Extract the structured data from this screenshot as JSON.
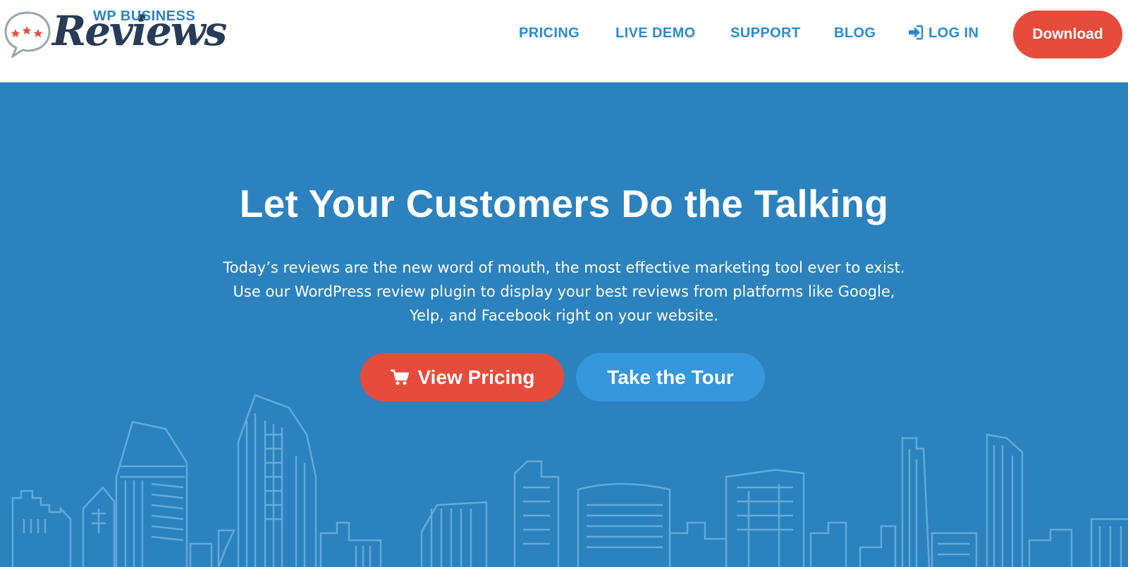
{
  "logo": {
    "small_text": "WP BUSINESS",
    "script_text": "Reviews",
    "icon": "speech-bubble-stars-icon"
  },
  "nav": {
    "links": [
      {
        "label": "PRICING"
      },
      {
        "label": "LIVE DEMO"
      },
      {
        "label": "SUPPORT"
      },
      {
        "label": "BLOG"
      },
      {
        "label": "LOG IN",
        "icon": "sign-in-icon"
      }
    ],
    "download_label": "Download"
  },
  "hero": {
    "headline": "Let Your Customers Do the Talking",
    "subtext_lines": [
      "Today’s reviews are the new word of mouth, the most effective marketing tool ever to exist.",
      "Use our WordPress review plugin to display your best reviews from platforms like Google,",
      "Yelp, and Facebook right on your website."
    ],
    "cta_primary": {
      "label": "View Pricing",
      "icon": "shopping-cart-icon"
    },
    "cta_secondary": {
      "label": "Take the Tour"
    },
    "background": "city-skyline-outline"
  },
  "colors": {
    "hero_bg": "#2b82be",
    "nav_link": "#2c8ad0",
    "accent_red": "#e64b3b",
    "accent_blue": "#3597dc",
    "logo_navy": "#283b57",
    "skyline_stroke": "#6fb0dc"
  }
}
